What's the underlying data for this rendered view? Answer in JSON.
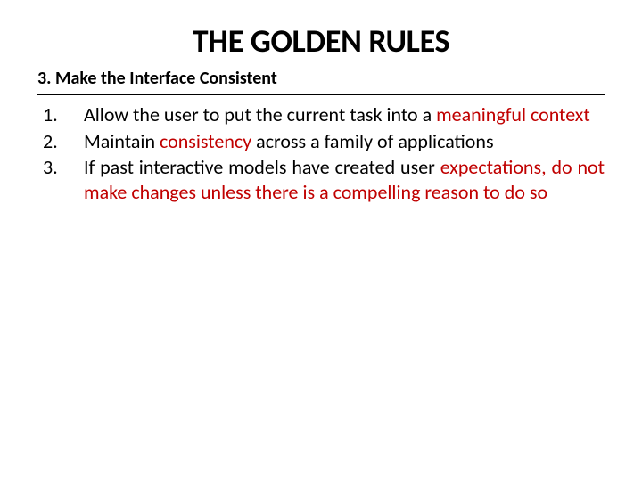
{
  "title": "THE GOLDEN RULES",
  "subtitle": "3. Make the Interface Consistent",
  "items": {
    "i1": {
      "pre": "Allow the user to put the current task into a ",
      "red": "meaningful context"
    },
    "i2": {
      "pre": "Maintain ",
      "red": "consistency",
      "post": " across a family of applications"
    },
    "i3": {
      "pre": "If past interactive models have created user ",
      "red": "expectations, do not make changes unless there is a compelling reason to do so"
    }
  }
}
